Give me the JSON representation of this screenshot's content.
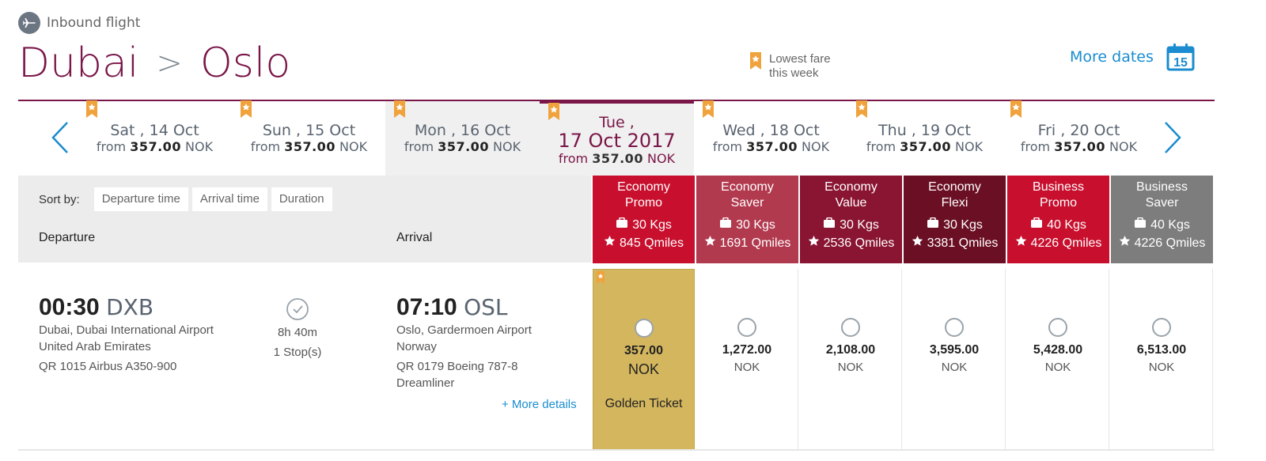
{
  "header": {
    "inbound_label": "Inbound flight",
    "origin": "Dubai",
    "destination": "Oslo",
    "lowest_fare_line1": "Lowest fare",
    "lowest_fare_line2": "this week",
    "more_dates": "More dates",
    "calendar_day": "15"
  },
  "dates": [
    {
      "day": "Sat , 14 Oct",
      "from": "from",
      "price": "357.00",
      "cur": "NOK"
    },
    {
      "day": "Sun , 15 Oct",
      "from": "from",
      "price": "357.00",
      "cur": "NOK"
    },
    {
      "day": "Mon , 16 Oct",
      "from": "from",
      "price": "357.00",
      "cur": "NOK"
    },
    {
      "day_line1": "Tue ,",
      "day_line2": "17 Oct 2017",
      "from": "from",
      "price": "357.00",
      "cur": "NOK"
    },
    {
      "day": "Wed , 18 Oct",
      "from": "from",
      "price": "357.00",
      "cur": "NOK"
    },
    {
      "day": "Thu , 19 Oct",
      "from": "from",
      "price": "357.00",
      "cur": "NOK"
    },
    {
      "day": "Fri , 20 Oct",
      "from": "from",
      "price": "357.00",
      "cur": "NOK"
    }
  ],
  "sort": {
    "label": "Sort by:",
    "options": [
      "Departure time",
      "Arrival time",
      "Duration"
    ],
    "col_departure": "Departure",
    "col_arrival": "Arrival"
  },
  "fares": [
    {
      "line1": "Economy",
      "line2": "Promo",
      "kg": "30 Kgs",
      "qmiles": "845 Qmiles",
      "color": "#c8102e"
    },
    {
      "line1": "Economy",
      "line2": "Saver",
      "kg": "30 Kgs",
      "qmiles": "1691 Qmiles",
      "color": "#b23a4f"
    },
    {
      "line1": "Economy",
      "line2": "Value",
      "kg": "30 Kgs",
      "qmiles": "2536 Qmiles",
      "color": "#8a1532"
    },
    {
      "line1": "Economy",
      "line2": "Flexi",
      "kg": "30 Kgs",
      "qmiles": "3381 Qmiles",
      "color": "#6b1024"
    },
    {
      "line1": "Business",
      "line2": "Promo",
      "kg": "40 Kgs",
      "qmiles": "4226 Qmiles",
      "color": "#c8102e"
    },
    {
      "line1": "Business",
      "line2": "Saver",
      "kg": "40 Kgs",
      "qmiles": "4226 Qmiles",
      "color": "#7d7d7d"
    }
  ],
  "flight": {
    "dep_time": "00:30",
    "dep_code": "DXB",
    "dep_airport": "Dubai, Dubai International Airport",
    "dep_country": "United Arab Emirates",
    "dep_flight": "QR 1015 Airbus A350-900",
    "duration": "8h 40m",
    "stops": "1 Stop(s)",
    "arr_time": "07:10",
    "arr_code": "OSL",
    "arr_airport": "Oslo, Gardermoen Airport",
    "arr_country": "Norway",
    "arr_flight_1": "QR 0179 Boeing 787-8",
    "arr_flight_2": "Dreamliner",
    "more_details": "+ More details"
  },
  "prices": [
    {
      "amount": "357.00",
      "cur": "NOK",
      "note": "Golden Ticket"
    },
    {
      "amount": "1,272.00",
      "cur": "NOK"
    },
    {
      "amount": "2,108.00",
      "cur": "NOK"
    },
    {
      "amount": "3,595.00",
      "cur": "NOK"
    },
    {
      "amount": "5,428.00",
      "cur": "NOK"
    },
    {
      "amount": "6,513.00",
      "cur": "NOK"
    }
  ]
}
